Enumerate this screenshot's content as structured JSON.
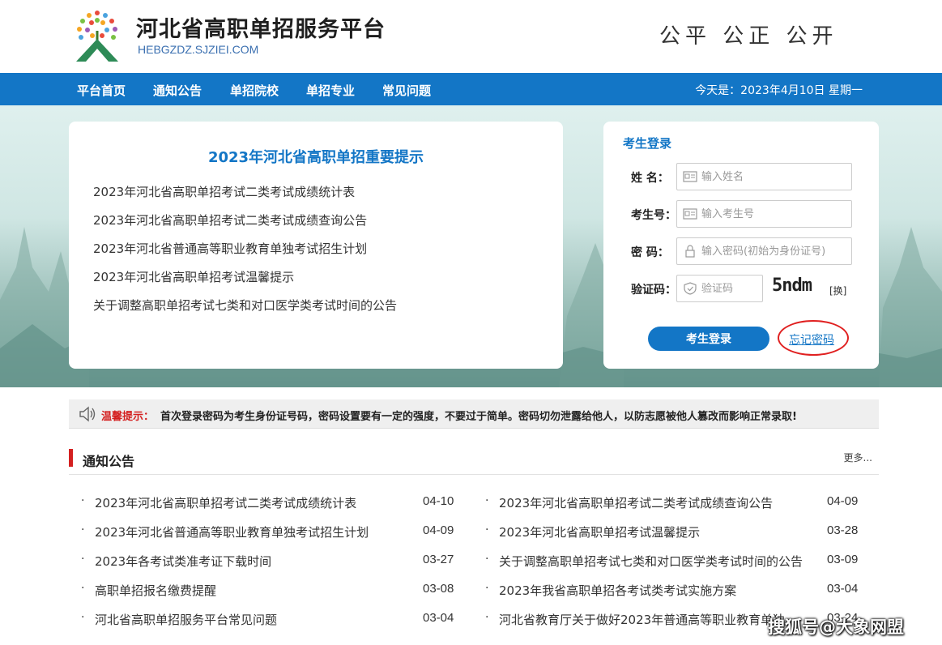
{
  "header": {
    "title": "河北省高职单招服务平台",
    "url_text": "HEBGZDZ.SJZIEI.COM",
    "slogan": "公平 公正 公开"
  },
  "nav": {
    "items": [
      "平台首页",
      "通知公告",
      "单招院校",
      "单招专业",
      "常见问题"
    ],
    "date_text": "今天是：2023年4月10日 星期一"
  },
  "tips_card": {
    "title": "2023年河北省高职单招重要提示",
    "items": [
      "2023年河北省高职单招考试二类考试成绩统计表",
      "2023年河北省高职单招考试二类考试成绩查询公告",
      "2023年河北省普通高等职业教育单独考试招生计划",
      "2023年河北省高职单招考试温馨提示",
      "关于调整高职单招考试七类和对口医学类考试时间的公告"
    ]
  },
  "login": {
    "title": "考生登录",
    "name_label": "姓  名：",
    "name_placeholder": "输入姓名",
    "id_label": "考生号：",
    "id_placeholder": "输入考生号",
    "password_label": "密  码：",
    "password_placeholder": "输入密码(初始为身份证号)",
    "captcha_label": "验证码：",
    "captcha_placeholder": "验证码",
    "captcha_text": "5ndm",
    "refresh_label": "[换]",
    "login_button": "考生登录",
    "forgot_link": "忘记密码"
  },
  "warm_tip": {
    "label": "温馨提示：",
    "text": "首次登录密码为考生身份证号码，密码设置要有一定的强度，不要过于简单。密码切勿泄露给他人，以防志愿被他人篡改而影响正常录取!"
  },
  "notices": {
    "title": "通知公告",
    "more": "更多...",
    "left": [
      {
        "title": "2023年河北省高职单招考试二类考试成绩统计表",
        "date": "04-10"
      },
      {
        "title": "2023年河北省普通高等职业教育单独考试招生计划",
        "date": "04-09"
      },
      {
        "title": "2023年各考试类准考证下载时间",
        "date": "03-27"
      },
      {
        "title": "高职单招报名缴费提醒",
        "date": "03-08"
      },
      {
        "title": "河北省高职单招服务平台常见问题",
        "date": "03-04"
      }
    ],
    "right": [
      {
        "title": "2023年河北省高职单招考试二类考试成绩查询公告",
        "date": "04-09"
      },
      {
        "title": "2023年河北省高职单招考试温馨提示",
        "date": "03-28"
      },
      {
        "title": "关于调整高职单招考试七类和对口医学类考试时间的公告",
        "date": "03-09"
      },
      {
        "title": "2023年我省高职单招各考试类考试实施方案",
        "date": "03-04"
      },
      {
        "title": "河北省教育厅关于做好2023年普通高等职业教育单独",
        "date": "03-24"
      }
    ]
  },
  "watermark": "搜狐号@大象网盟",
  "colors": {
    "primary": "#1376c6",
    "accent_red": "#d42020"
  }
}
